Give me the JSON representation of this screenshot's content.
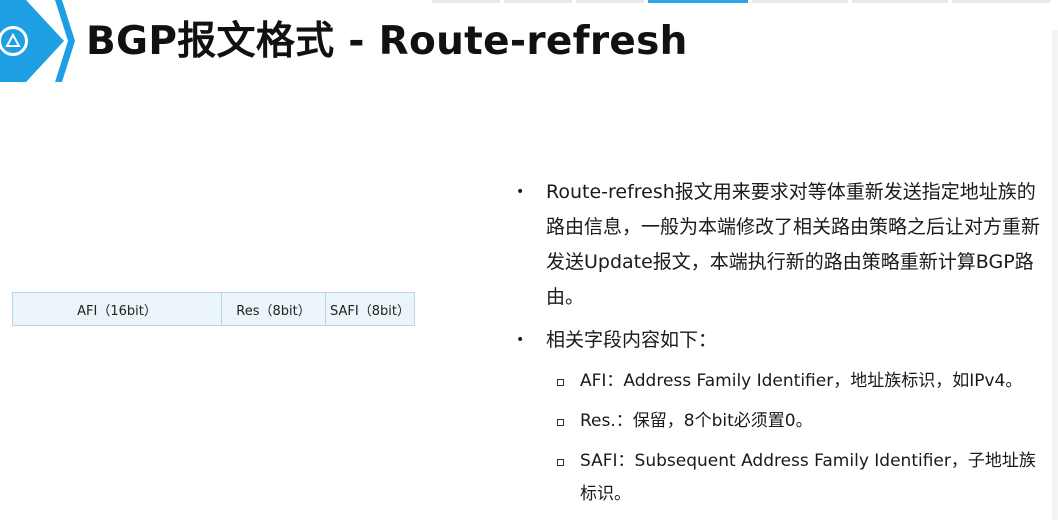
{
  "header": {
    "title": "BGP报文格式 - Route-refresh"
  },
  "packet_table": {
    "cells": [
      "AFI（16bit）",
      "Res（8bit）",
      "SAFI（8bit）"
    ]
  },
  "bullets": {
    "item1": "Route-refresh报文用来要求对等体重新发送指定地址族的路由信息，一般为本端修改了相关路由策略之后让对方重新发送Update报文，本端执行新的路由策略重新计算BGP路由。",
    "item2": "相关字段内容如下：",
    "sub_items": [
      "AFI：Address Family Identifier，地址族标识，如IPv4。",
      "Res.：保留，8个bit必须置0。",
      "SAFI：Subsequent  Address Family Identifier，子地址族标识。"
    ]
  },
  "colors": {
    "accent": "#1f9fe3",
    "table_fill": "#ebf4f9",
    "table_border": "#b8d6e6"
  },
  "icons": {
    "logo": "logo-badge-icon"
  }
}
